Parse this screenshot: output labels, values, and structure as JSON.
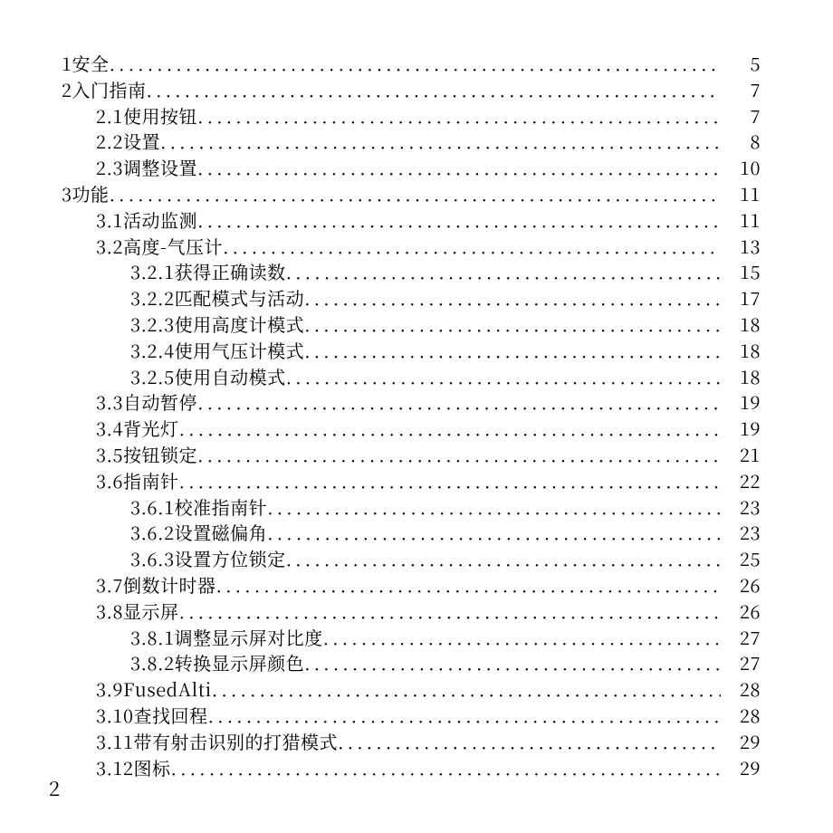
{
  "page_number": "2",
  "entries": [
    {
      "indent": 0,
      "num": "1",
      "title": "安全",
      "page": "5"
    },
    {
      "indent": 0,
      "num": "2",
      "title": "入门指南",
      "page": "7"
    },
    {
      "indent": 1,
      "num": "2.1",
      "title": "使用按钮",
      "page": "7"
    },
    {
      "indent": 1,
      "num": "2.2",
      "title": "设置",
      "page": "8"
    },
    {
      "indent": 1,
      "num": "2.3",
      "title": "调整设置",
      "page": "10"
    },
    {
      "indent": 0,
      "num": "3",
      "title": "功能",
      "page": "11"
    },
    {
      "indent": 1,
      "num": "3.1",
      "title": "活动监测",
      "page": "11"
    },
    {
      "indent": 1,
      "num": "3.2",
      "title": "高度-气压计",
      "page": "13"
    },
    {
      "indent": 2,
      "num": "3.2.1",
      "title": "获得正确读数",
      "page": "15"
    },
    {
      "indent": 2,
      "num": "3.2.2",
      "title": "匹配模式与活动",
      "page": "17"
    },
    {
      "indent": 2,
      "num": "3.2.3",
      "title": "使用高度计模式",
      "page": "18"
    },
    {
      "indent": 2,
      "num": "3.2.4",
      "title": "使用气压计模式",
      "page": "18"
    },
    {
      "indent": 2,
      "num": "3.2.5",
      "title": "使用自动模式",
      "page": "18"
    },
    {
      "indent": 1,
      "num": "3.3",
      "title": "自动暂停",
      "page": "19"
    },
    {
      "indent": 1,
      "num": "3.4",
      "title": "背光灯",
      "page": "19"
    },
    {
      "indent": 1,
      "num": "3.5",
      "title": "按钮锁定",
      "page": "21"
    },
    {
      "indent": 1,
      "num": "3.6",
      "title": "指南针",
      "page": "22"
    },
    {
      "indent": 2,
      "num": "3.6.1",
      "title": "校准指南针",
      "page": "23"
    },
    {
      "indent": 2,
      "num": "3.6.2",
      "title": "设置磁偏角",
      "page": "23"
    },
    {
      "indent": 2,
      "num": "3.6.3",
      "title": "设置方位锁定",
      "page": "25"
    },
    {
      "indent": 1,
      "num": "3.7",
      "title": "倒数计时器",
      "page": "26"
    },
    {
      "indent": 1,
      "num": "3.8",
      "title": "显示屏",
      "page": "26"
    },
    {
      "indent": 2,
      "num": "3.8.1",
      "title": "调整显示屏对比度",
      "page": "27"
    },
    {
      "indent": 2,
      "num": "3.8.2",
      "title": "转换显示屏颜色",
      "page": "27"
    },
    {
      "indent": 1,
      "num": "3.9",
      "title": "FusedAlti",
      "page": "28"
    },
    {
      "indent": 1,
      "num": "3.10",
      "title": "查找回程",
      "page": "28"
    },
    {
      "indent": 1,
      "num": "3.11",
      "title": "带有射击识别的打猎模式",
      "page": "29"
    },
    {
      "indent": 1,
      "num": "3.12",
      "title": "图标",
      "page": "29"
    }
  ]
}
